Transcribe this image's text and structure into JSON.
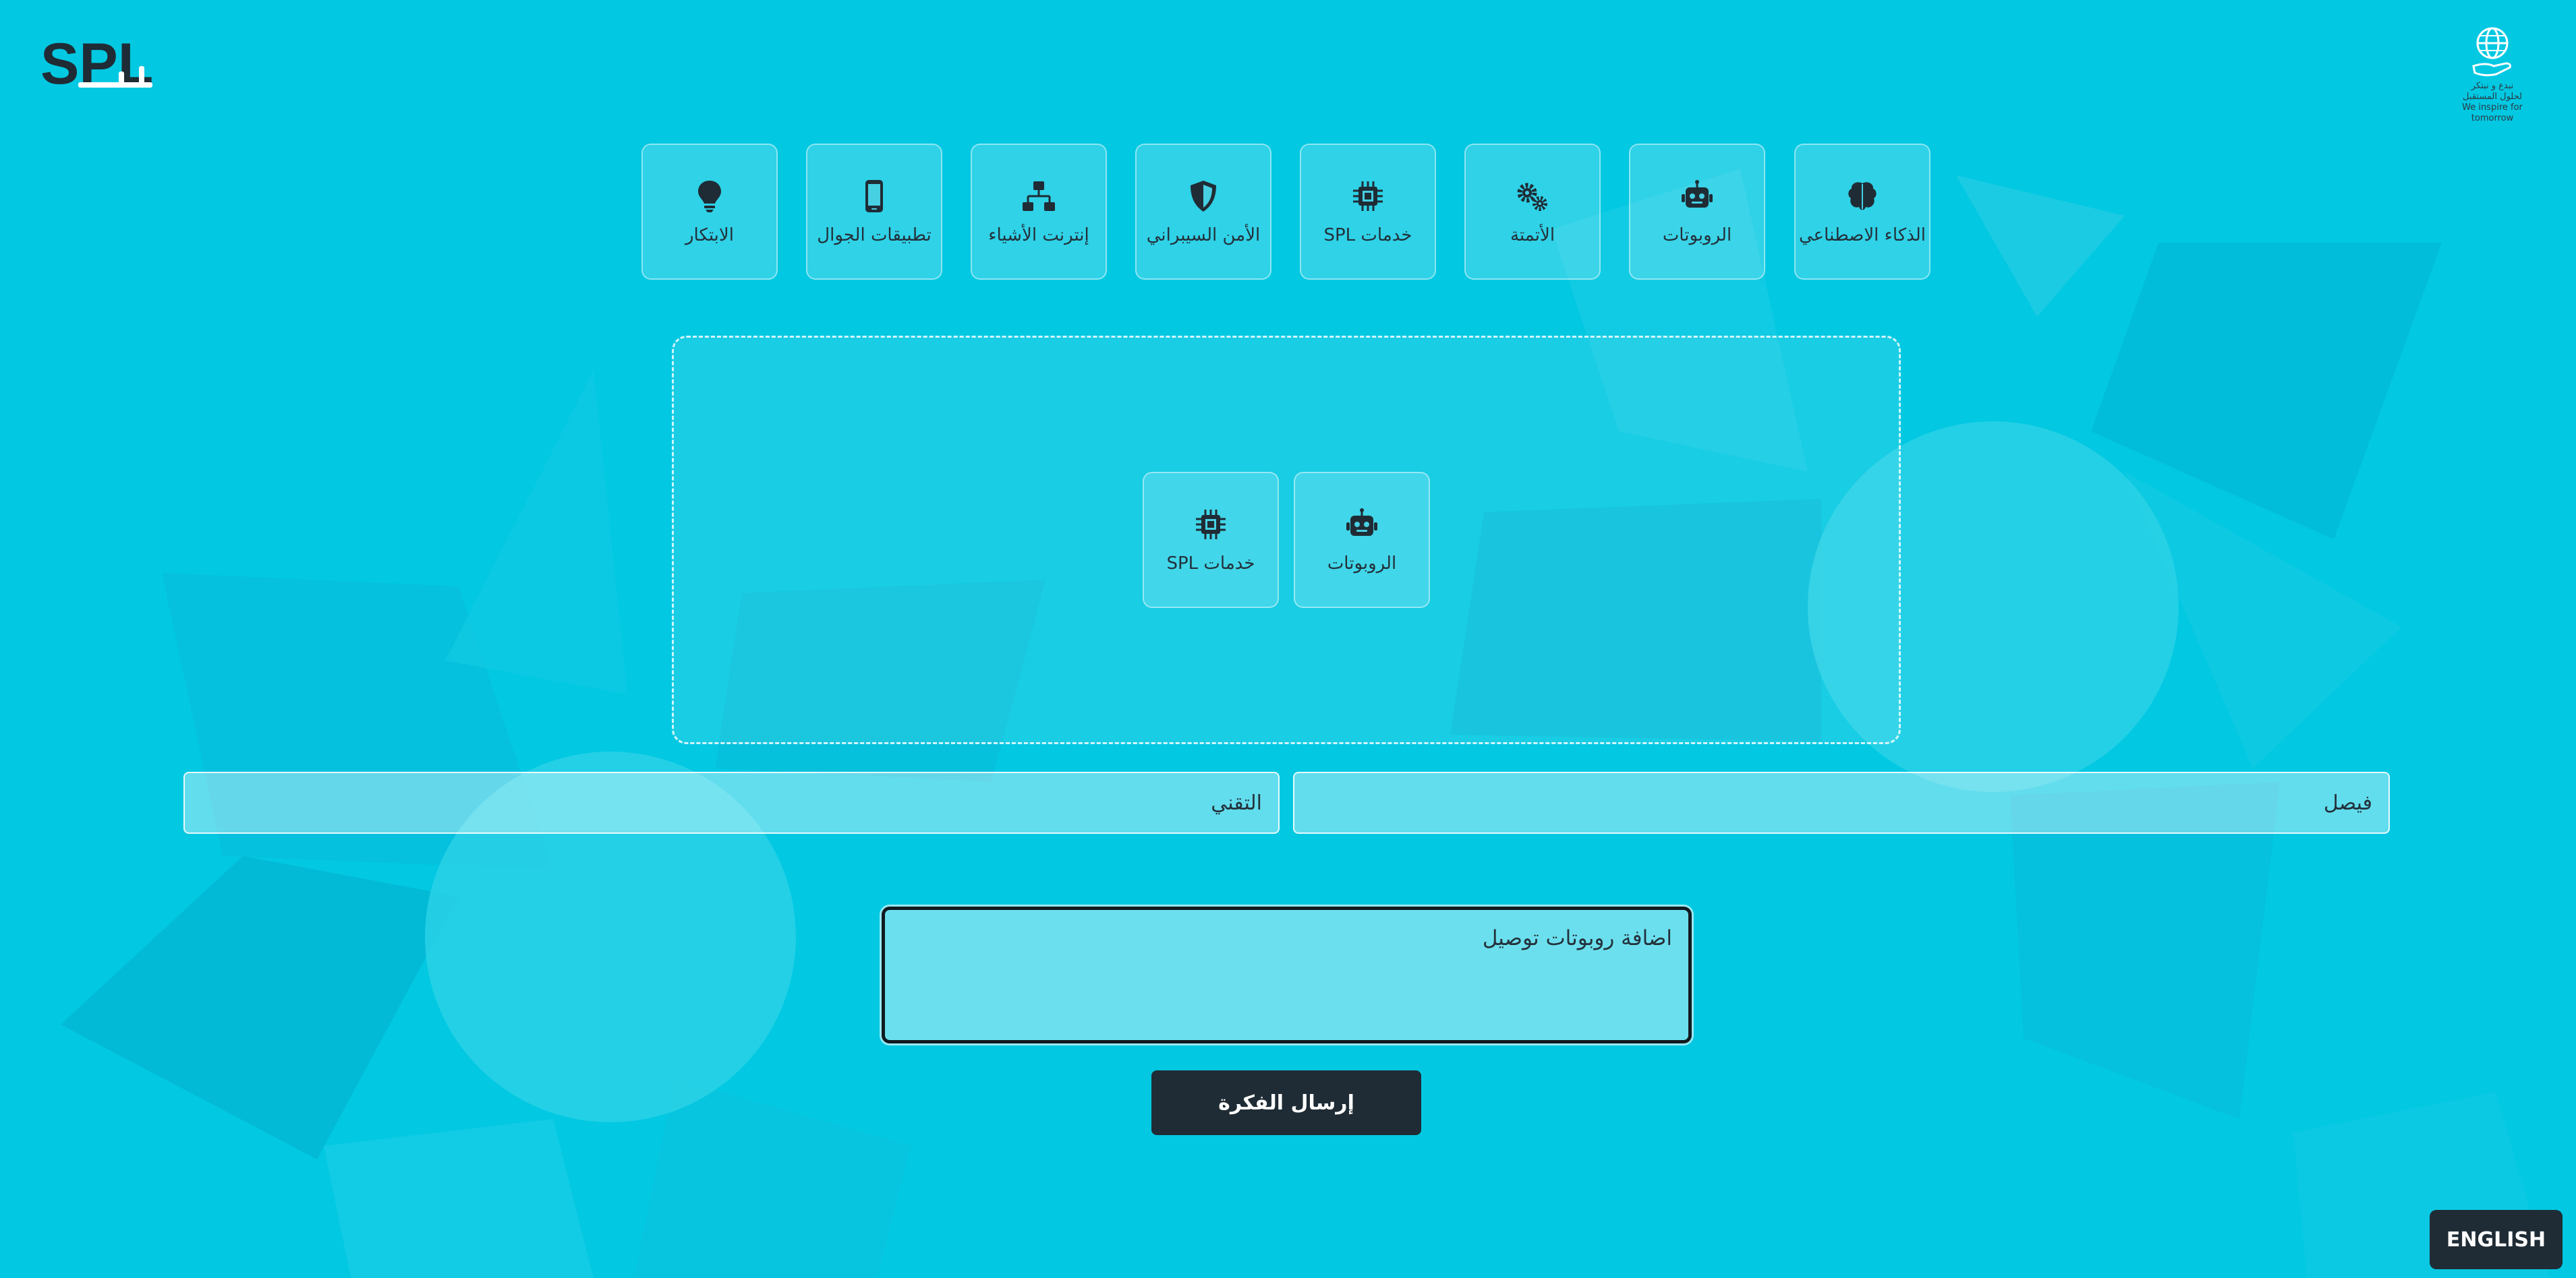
{
  "header": {
    "logo_text": "SPL",
    "brand_lines": [
      "نبدع و نبتكر",
      "لحلول المستقبل",
      "We inspire for",
      "tomorrow"
    ]
  },
  "categories": [
    {
      "label": "الذكاء الاصطناعي",
      "icon": "brain-icon"
    },
    {
      "label": "الروبوتات",
      "icon": "robot-icon"
    },
    {
      "label": "الأتمتة",
      "icon": "gears-icon"
    },
    {
      "label": "خدمات SPL",
      "icon": "chip-icon"
    },
    {
      "label": "الأمن السيبراني",
      "icon": "shield-icon"
    },
    {
      "label": "إنترنت الأشياء",
      "icon": "network-icon"
    },
    {
      "label": "تطبيقات الجوال",
      "icon": "mobile-icon"
    },
    {
      "label": "الابتكار",
      "icon": "lightbulb-icon"
    }
  ],
  "selected": [
    {
      "label": "الروبوتات",
      "icon": "robot-icon"
    },
    {
      "label": "خدمات SPL",
      "icon": "chip-icon"
    }
  ],
  "form": {
    "name_value": "فيصل",
    "department_value": "التقني",
    "idea_value": "اضافة روبوتات توصيل",
    "submit_label": "إرسال الفكرة"
  },
  "language_toggle": "ENGLISH",
  "colors": {
    "background": "#02c8e2",
    "button": "#1f2c35",
    "text": "#23313b"
  }
}
